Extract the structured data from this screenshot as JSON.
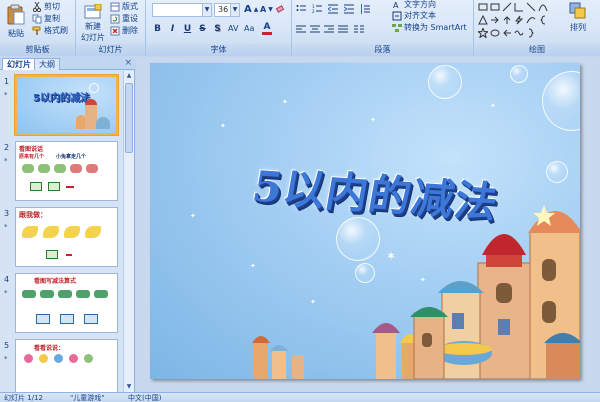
{
  "ribbon": {
    "clipboard": {
      "paste": "粘贴",
      "cut": "剪切",
      "copy": "复制",
      "format_painter": "格式刷",
      "label": "剪贴板"
    },
    "slides": {
      "new_slide_line1": "新建",
      "new_slide_line2": "幻灯片",
      "layout": "版式",
      "reset": "重设",
      "delete": "删除",
      "label": "幻灯片"
    },
    "font": {
      "font_size": "36",
      "bold": "B",
      "italic": "I",
      "underline": "U",
      "strike": "S",
      "shadow": "S",
      "label": "字体"
    },
    "paragraph": {
      "text_direction": "文字方向",
      "align_text": "对齐文本",
      "smartart": "转换为 SmartArt",
      "label": "段落"
    },
    "drawing": {
      "arrange": "排列",
      "label": "绘图"
    }
  },
  "panel": {
    "tab_slides": "幻灯片",
    "tab_outline": "大纲",
    "close": "×",
    "thumbnails": [
      {
        "num": "1",
        "title": "5以内的减法",
        "selected": true
      },
      {
        "num": "2",
        "title": "看图说话",
        "lines": [
          "原来有几个",
          "小兔拿走几个"
        ]
      },
      {
        "num": "3",
        "title": "跟我做："
      },
      {
        "num": "4",
        "title": "看图写减法算式"
      },
      {
        "num": "5",
        "title": "看看说说："
      }
    ],
    "star": "*"
  },
  "slide": {
    "title": "5以内的减法"
  },
  "status": {
    "slide_of": "幻灯片 1/12",
    "theme": "\"儿童游戏\"",
    "language": "中文(中国)"
  },
  "colors": {
    "accent": "#3d78d9",
    "ribbon_bg": "#d8e6f7",
    "selection": "#f1b34a"
  }
}
